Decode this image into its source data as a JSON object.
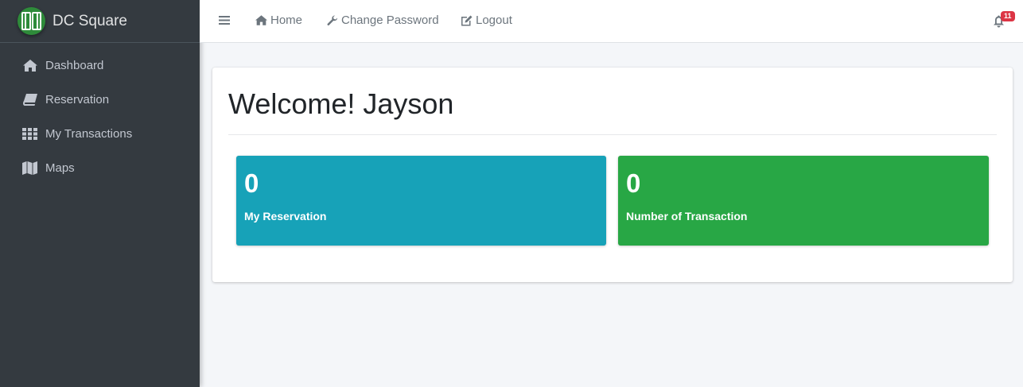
{
  "brand": {
    "name": "DC Square",
    "logo_icon": "dc-logo"
  },
  "sidebar": {
    "items": [
      {
        "label": "Dashboard",
        "icon": "home-icon"
      },
      {
        "label": "Reservation",
        "icon": "book-icon"
      },
      {
        "label": "My Transactions",
        "icon": "th-icon"
      },
      {
        "label": "Maps",
        "icon": "map-icon"
      }
    ]
  },
  "navbar": {
    "home_label": "Home",
    "change_password_label": "Change Password",
    "logout_label": "Logout",
    "notification_count": "11"
  },
  "main": {
    "welcome": "Welcome! Jayson",
    "boxes": [
      {
        "value": "0",
        "label": "My Reservation",
        "color": "#17a2b8"
      },
      {
        "value": "0",
        "label": "Number of Transaction",
        "color": "#28a745"
      }
    ]
  },
  "colors": {
    "sidebar_bg": "#343a40",
    "content_bg": "#f4f6f9",
    "badge": "#dc3545"
  }
}
